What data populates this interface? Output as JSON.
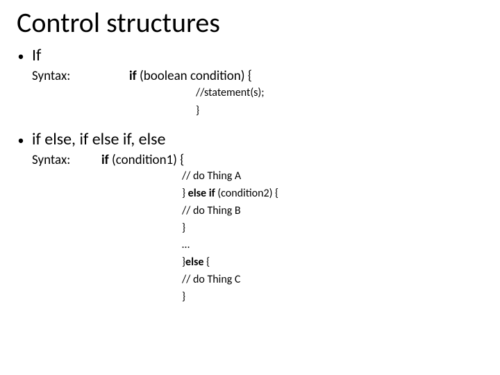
{
  "title": "Control structures",
  "bullets": {
    "b1": "If",
    "b2": "if else, if else if, else"
  },
  "syntax_label": "Syntax:",
  "sec1": {
    "if_kw": "if",
    "cond": " (boolean condition) {",
    "stmt": "//statement(s);",
    "close": "}"
  },
  "sec2": {
    "if_kw": "if",
    "cond1": " (condition1) {",
    "thingA": "// do Thing A",
    "elseif_close": "} ",
    "elseif_kw": "else if",
    "cond2": " (condition2) {",
    "thingB": "// do Thing B",
    "close_mid": "}",
    "ellipsis": " …",
    "else_close": "}",
    "else_kw": "else",
    "else_open": " {",
    "thingC": "// do Thing C",
    "close_end": "}"
  }
}
